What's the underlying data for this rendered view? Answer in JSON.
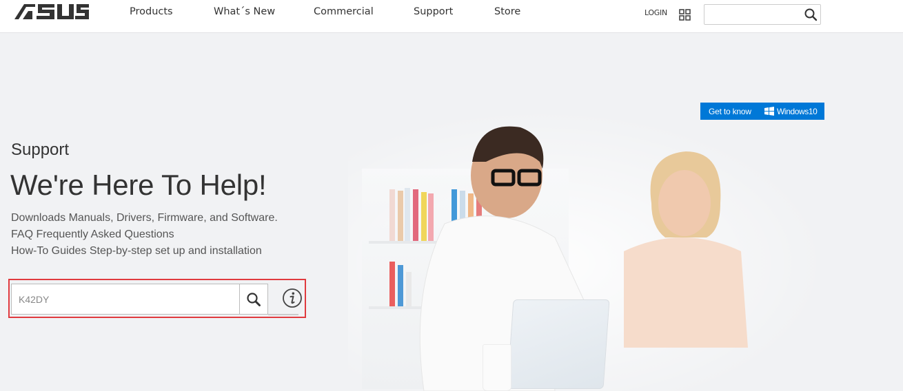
{
  "header": {
    "brand": "ASUS",
    "nav": [
      {
        "label": "Products"
      },
      {
        "label": "What´s New"
      },
      {
        "label": "Commercial"
      },
      {
        "label": "Support"
      },
      {
        "label": "Store"
      }
    ],
    "login_label": "LOGIN",
    "apps_icon": "grid-icon",
    "search": {
      "value": "",
      "placeholder": "",
      "icon": "search-icon"
    }
  },
  "hero": {
    "badge": {
      "prefix": "Get to know",
      "product": "Windows10",
      "icon": "windows-logo-icon",
      "color": "#0078d7"
    },
    "image_alt": "Two people smiling while using a laptop in front of a bookshelf"
  },
  "main": {
    "section_label": "Support",
    "headline": "We're Here To Help!",
    "features": [
      "Downloads Manuals, Drivers, Firmware, and Software.",
      "FAQ Frequently Asked Questions",
      "How-To Guides Step-by-step set up and installation"
    ],
    "model_search": {
      "value": "K42DY",
      "placeholder": "",
      "icon": "search-icon"
    },
    "info_icon": "info-icon",
    "highlight_color": "#e03a3e"
  }
}
